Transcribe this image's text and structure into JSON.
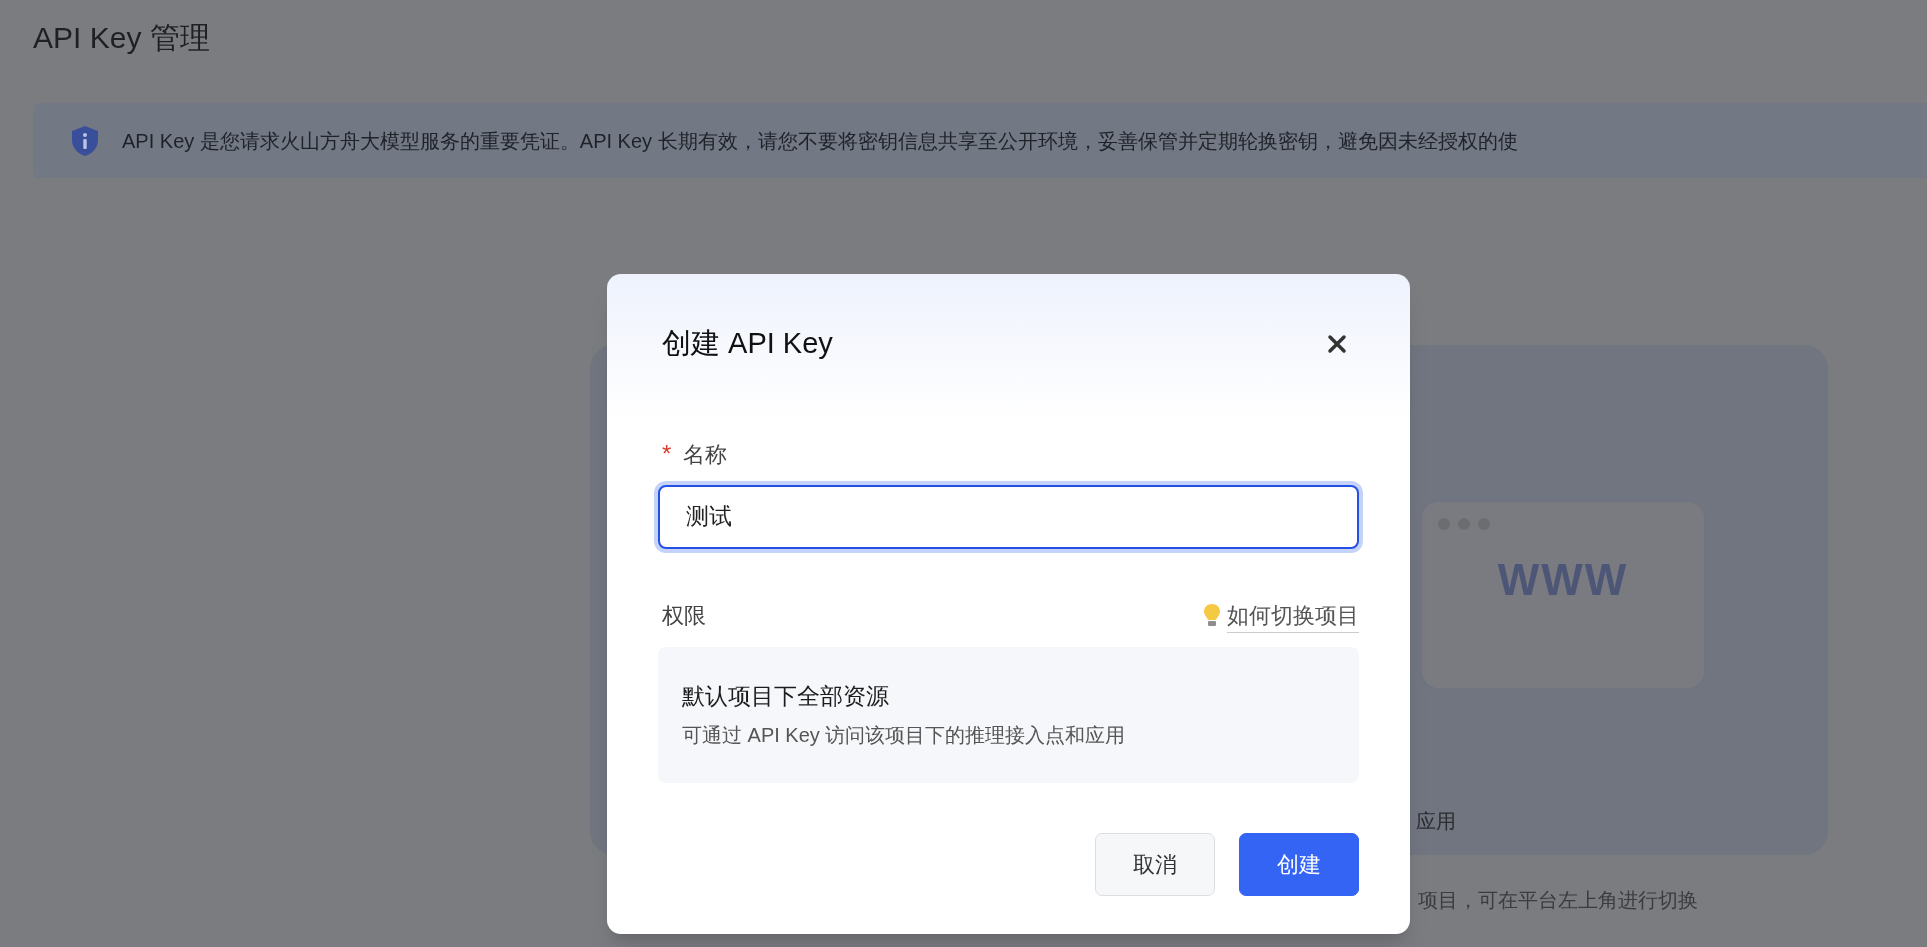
{
  "page": {
    "title": "API Key 管理"
  },
  "notice": {
    "text": "API Key 是您请求火山方舟大模型服务的重要凭证。API Key 长期有效，请您不要将密钥信息共享至公开环境，妥善保管并定期轮换密钥，避免因未经授权的使"
  },
  "background_card": {
    "illustration_text": "WWW",
    "caption": "应用"
  },
  "footer_note": "项目，可在平台左上角进行切换",
  "dialog": {
    "title": "创建 API Key",
    "name_field": {
      "label": "名称",
      "required": true,
      "required_mark": "*",
      "value": "测试",
      "focused": true
    },
    "permission": {
      "label": "权限",
      "help_link": "如何切换项目",
      "option_title": "默认项目下全部资源",
      "option_description": "可通过 API Key 访问该项目下的推理接入点和应用"
    },
    "buttons": [
      {
        "label": "取消",
        "kind": "secondary"
      },
      {
        "label": "创建",
        "kind": "primary"
      }
    ]
  }
}
